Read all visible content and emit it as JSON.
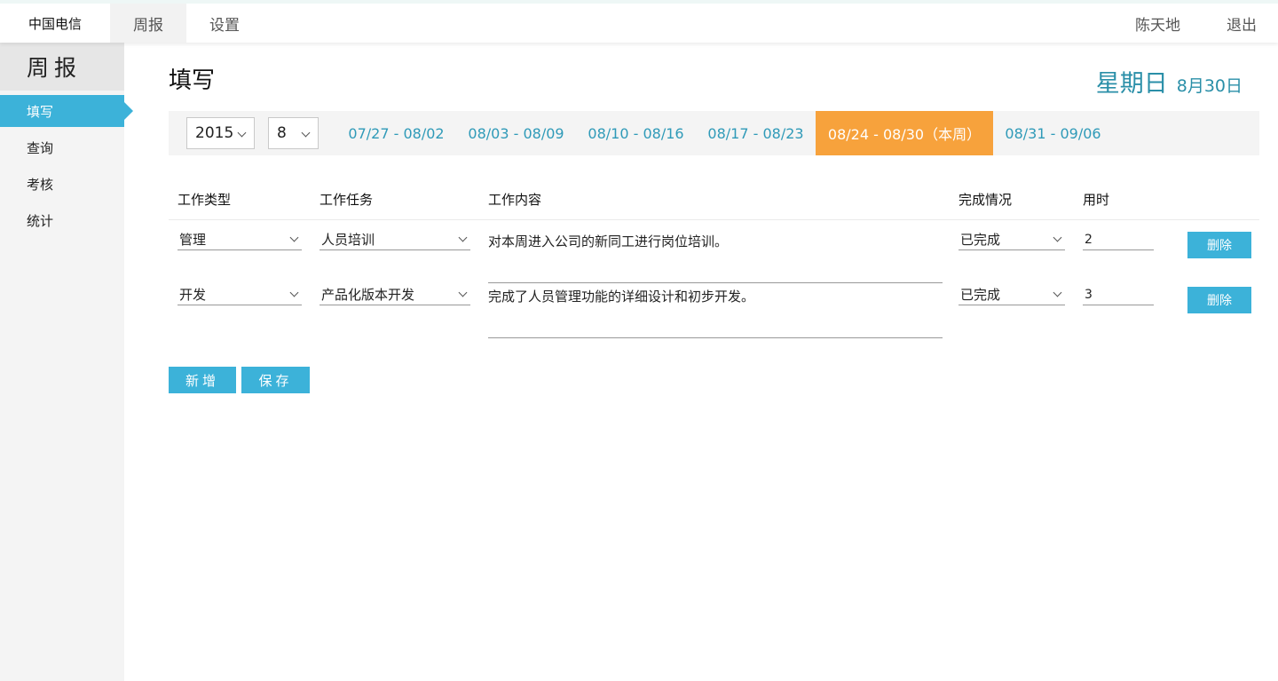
{
  "topbar": {
    "brand": "中国电信",
    "tabs": [
      {
        "label": "周报",
        "active": true
      },
      {
        "label": "设置",
        "active": false
      }
    ],
    "user": "陈天地",
    "logout": "退出"
  },
  "sidebar": {
    "title": "周报",
    "items": [
      {
        "label": "填写",
        "active": true
      },
      {
        "label": "查询",
        "active": false
      },
      {
        "label": "考核",
        "active": false
      },
      {
        "label": "统计",
        "active": false
      }
    ]
  },
  "main": {
    "title": "填写",
    "weekday": "星期日",
    "date": "8月30日",
    "year_select": "2015",
    "month_select": "8",
    "weeks": [
      {
        "label": "07/27 - 08/02",
        "current": false
      },
      {
        "label": "08/03 - 08/09",
        "current": false
      },
      {
        "label": "08/10 - 08/16",
        "current": false
      },
      {
        "label": "08/17 - 08/23",
        "current": false
      },
      {
        "label": "08/24 - 08/30（本周）",
        "current": true
      },
      {
        "label": "08/31 - 09/06",
        "current": false
      }
    ],
    "columns": [
      "工作类型",
      "工作任务",
      "工作内容",
      "完成情况",
      "用时"
    ],
    "rows": [
      {
        "type": "管理",
        "task": "人员培训",
        "content": "对本周进入公司的新同工进行岗位培训。",
        "status": "已完成",
        "hours": "2",
        "delete": "删除"
      },
      {
        "type": "开发",
        "task": "产品化版本开发",
        "content": "完成了人员管理功能的详细设计和初步开发。",
        "status": "已完成",
        "hours": "3",
        "delete": "删除"
      }
    ],
    "add_label": "新增",
    "save_label": "保存"
  },
  "colors": {
    "accent": "#3cb2d9",
    "current_week": "#f7a23c",
    "link": "#2f9ab8"
  }
}
